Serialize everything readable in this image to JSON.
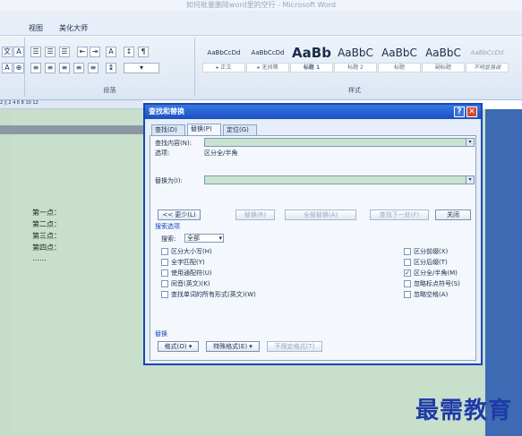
{
  "window": {
    "title": "如何批量删除word里的空行 - Microsoft Word"
  },
  "tabs": {
    "view": "视图",
    "beautify": "美化大师"
  },
  "ribbon": {
    "paragraph_label": "段落",
    "styles_label": "样式",
    "styles": [
      {
        "preview": "AaBbCcDd",
        "name": "▸ 正文"
      },
      {
        "preview": "AaBbCcDd",
        "name": "▸ 无间隔"
      },
      {
        "preview": "AaBb",
        "name": "标题 1"
      },
      {
        "preview": "AaBbC",
        "name": "标题 2"
      },
      {
        "preview": "AaBbC",
        "name": "标题"
      },
      {
        "preview": "AaBbC",
        "name": "副标题"
      },
      {
        "preview": "AaBbCcDd",
        "name": "不明显强调"
      }
    ]
  },
  "ruler": {
    "ticks": "2 ╳ 2 4 6 8 10 12"
  },
  "document": {
    "lines": [
      "第一点：",
      "第二点：",
      "第三点：",
      "第四点：",
      "……"
    ]
  },
  "dialog": {
    "title": "查找和替换",
    "help": "?",
    "close": "✕",
    "tabs": [
      "查找(D)",
      "替换(P)",
      "定位(G)"
    ],
    "find_label": "查找内容(N):",
    "options_label": "选项:",
    "options_value": "区分全/半角",
    "replace_label": "替换为(I):",
    "buttons": {
      "less": "<< 更少(L)",
      "replace": "替换(R)",
      "replace_all": "全部替换(A)",
      "find_next": "查找下一处(F)",
      "close": "关闭"
    },
    "search_options_title": "搜索选项",
    "search_label": "搜索:",
    "search_value": "全部",
    "checks_left": [
      {
        "label": "区分大小写(H)",
        "checked": false
      },
      {
        "label": "全字匹配(Y)",
        "checked": false
      },
      {
        "label": "使用通配符(U)",
        "checked": false
      },
      {
        "label": "同音(英文)(K)",
        "checked": false
      },
      {
        "label": "查找单词的所有形式(英文)(W)",
        "checked": false
      }
    ],
    "checks_right": [
      {
        "label": "区分前缀(X)",
        "checked": false
      },
      {
        "label": "区分后缀(T)",
        "checked": false
      },
      {
        "label": "区分全/半角(M)",
        "checked": true
      },
      {
        "label": "忽略标点符号(S)",
        "checked": false
      },
      {
        "label": "忽略空格(A)",
        "checked": false
      }
    ],
    "replace_section": "替换",
    "format_btn": "格式(O) ▾",
    "special_btn": "特殊格式(E) ▾",
    "no_format_btn": "不限定格式(T)"
  },
  "watermark": "最需教育"
}
